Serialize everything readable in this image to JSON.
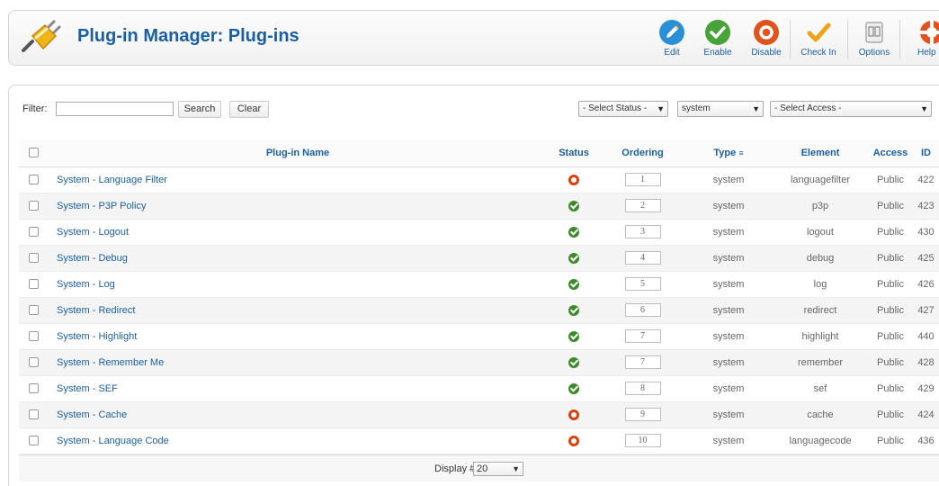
{
  "header": {
    "title": "Plug-in Manager: Plug-ins",
    "toolbar": [
      {
        "label": "Edit",
        "icon": "edit-icon"
      },
      {
        "label": "Enable",
        "icon": "enable-icon"
      },
      {
        "label": "Disable",
        "icon": "disable-icon"
      },
      {
        "label": "Check In",
        "icon": "checkin-icon"
      },
      {
        "label": "Options",
        "icon": "options-icon"
      },
      {
        "label": "Help",
        "icon": "help-icon"
      }
    ]
  },
  "filter": {
    "label": "Filter:",
    "value": "",
    "search_label": "Search",
    "clear_label": "Clear",
    "status_select": "- Select Status -",
    "type_select": "system",
    "access_select": "- Select Access -"
  },
  "table": {
    "columns": {
      "name": "Plug-in Name",
      "status": "Status",
      "ordering": "Ordering",
      "type": "Type",
      "element": "Element",
      "access": "Access",
      "id": "ID"
    },
    "rows": [
      {
        "name": "System - Language Filter",
        "status": "disabled",
        "ordering": "1",
        "type": "system",
        "element": "languagefilter",
        "access": "Public",
        "id": "422"
      },
      {
        "name": "System - P3P Policy",
        "status": "enabled",
        "ordering": "2",
        "type": "system",
        "element": "p3p",
        "access": "Public",
        "id": "423"
      },
      {
        "name": "System - Logout",
        "status": "enabled",
        "ordering": "3",
        "type": "system",
        "element": "logout",
        "access": "Public",
        "id": "430"
      },
      {
        "name": "System - Debug",
        "status": "enabled",
        "ordering": "4",
        "type": "system",
        "element": "debug",
        "access": "Public",
        "id": "425"
      },
      {
        "name": "System - Log",
        "status": "enabled",
        "ordering": "5",
        "type": "system",
        "element": "log",
        "access": "Public",
        "id": "426"
      },
      {
        "name": "System - Redirect",
        "status": "enabled",
        "ordering": "6",
        "type": "system",
        "element": "redirect",
        "access": "Public",
        "id": "427"
      },
      {
        "name": "System - Highlight",
        "status": "enabled",
        "ordering": "7",
        "type": "system",
        "element": "highlight",
        "access": "Public",
        "id": "440"
      },
      {
        "name": "System - Remember Me",
        "status": "enabled",
        "ordering": "7",
        "type": "system",
        "element": "remember",
        "access": "Public",
        "id": "428"
      },
      {
        "name": "System - SEF",
        "status": "enabled",
        "ordering": "8",
        "type": "system",
        "element": "sef",
        "access": "Public",
        "id": "429"
      },
      {
        "name": "System - Cache",
        "status": "disabled",
        "ordering": "9",
        "type": "system",
        "element": "cache",
        "access": "Public",
        "id": "424"
      },
      {
        "name": "System - Language Code",
        "status": "disabled",
        "ordering": "10",
        "type": "system",
        "element": "languagecode",
        "access": "Public",
        "id": "436"
      }
    ]
  },
  "footer": {
    "display_label": "Display #",
    "display_value": "20"
  },
  "colors": {
    "accent": "#1b5fa3",
    "enabled": "#3d8a2d",
    "disabled": "#d2440f"
  }
}
